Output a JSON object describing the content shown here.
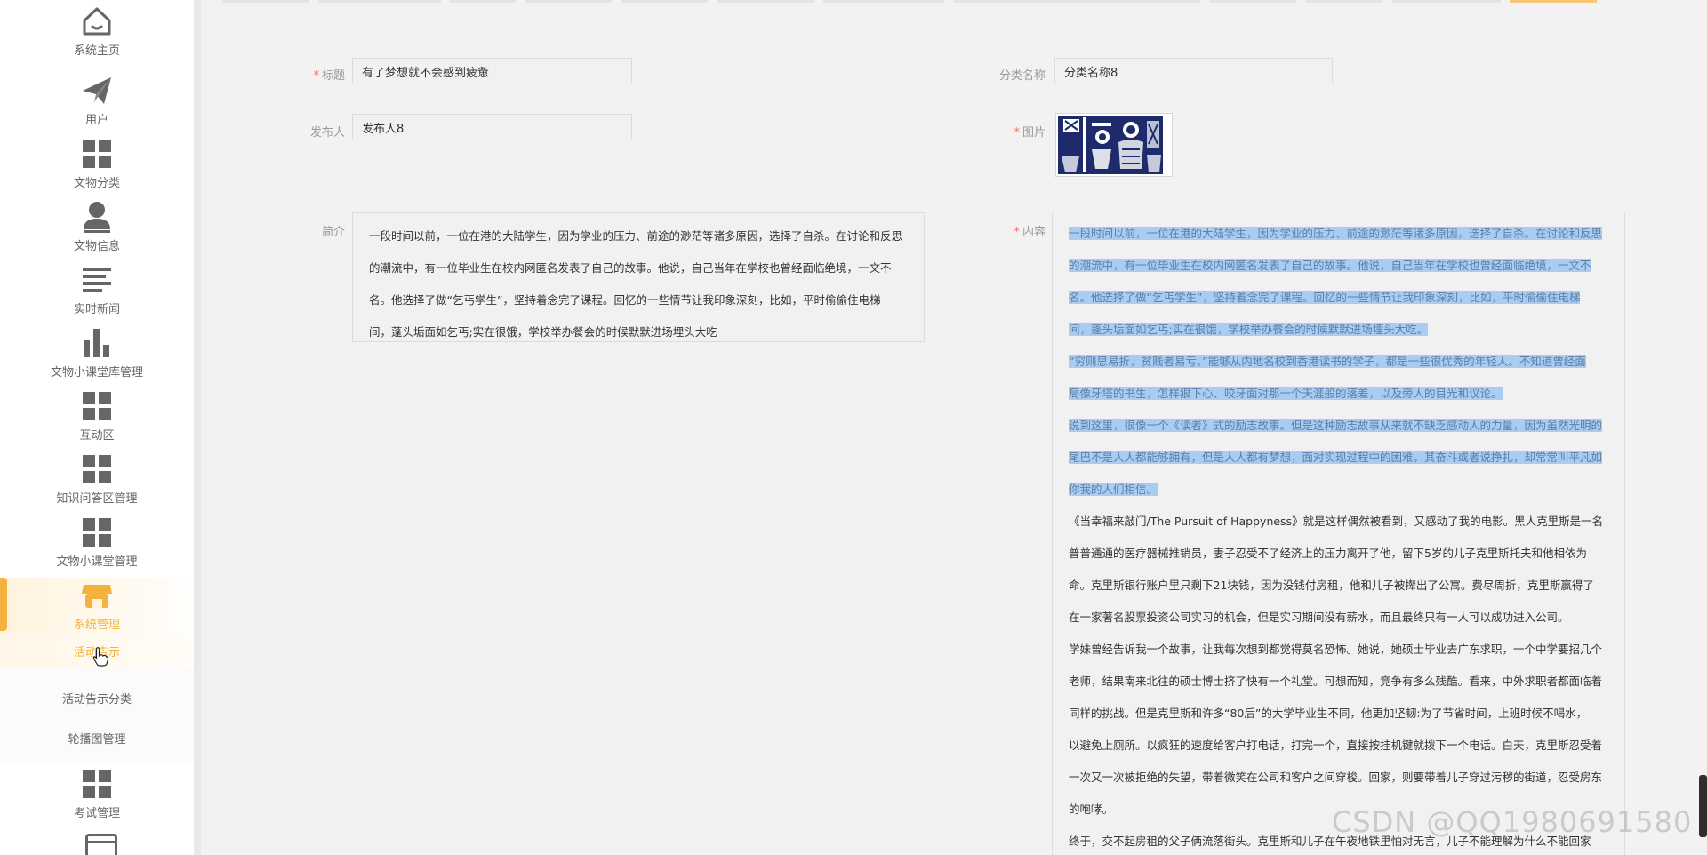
{
  "colors": {
    "accent": "#f3b23d",
    "required": "#f56c6c",
    "highlight": "#a9cdf0",
    "icon": "#666666"
  },
  "sidebar": {
    "items": [
      {
        "label": "系统主页",
        "icon": "home-icon"
      },
      {
        "label": "用户",
        "icon": "paper-plane-icon"
      },
      {
        "label": "文物分类",
        "icon": "grid-icon"
      },
      {
        "label": "文物信息",
        "icon": "user-icon"
      },
      {
        "label": "实时新闻",
        "icon": "list-icon"
      },
      {
        "label": "文物小课堂库管理",
        "icon": "bar-chart-icon"
      },
      {
        "label": "互动区",
        "icon": "grid-icon"
      },
      {
        "label": "知识问答区管理",
        "icon": "grid-icon"
      },
      {
        "label": "文物小课堂管理",
        "icon": "grid-icon"
      },
      {
        "label": "系统管理",
        "icon": "shop-icon",
        "active": true
      },
      {
        "label": "考试管理",
        "icon": "grid-icon"
      }
    ],
    "sub_items": [
      {
        "label": "活动告示",
        "active": true
      },
      {
        "label": "活动告示分类"
      },
      {
        "label": "轮播图管理"
      }
    ]
  },
  "form": {
    "title": {
      "label": "标题",
      "required": true,
      "value": "有了梦想就不会感到疲惫"
    },
    "category": {
      "label": "分类名称",
      "required": false,
      "value": "分类名称8"
    },
    "publisher": {
      "label": "发布人",
      "required": false,
      "value": "发布人8"
    },
    "image": {
      "label": "图片",
      "required": true
    },
    "summary": {
      "label": "简介",
      "required": false,
      "lines": [
        "一段时间以前，一位在港的大陆学生，因为学业的压力、前途的渺茫等诸多原因，选择了自杀。在讨论和反思",
        "的潮流中，有一位毕业生在校内网匿名发表了自己的故事。他说，自己当年在学校也曾经面临绝境，一文不",
        "名。他选择了做“乞丐学生”，坚持着念完了课程。回忆的一些情节让我印象深刻，比如，平时偷偷住电梯",
        "间，蓬头垢面如乞丐;实在很饿，学校举办餐会的时候默默进场埋头大吃"
      ]
    },
    "content": {
      "label": "内容",
      "required": true,
      "highlighted_lines": [
        "一段时间以前，一位在港的大陆学生，因为学业的压力、前途的渺茫等诸多原因，选择了自杀。在讨论和反思",
        "的潮流中，有一位毕业生在校内网匿名发表了自己的故事。他说，自己当年在学校也曾经面临绝境，一文不",
        "名。他选择了做“乞丐学生”，坚持着念完了课程。回忆的一些情节让我印象深刻，比如，平时偷偷住电梯",
        "间，蓬头垢面如乞丐;实在很饿，学校举办餐会的时候默默进场埋头大吃。",
        "“穷则思易折，贫贱者易亏。”能够从内地名校到香港读书的学子，都是一些很优秀的年轻人。不知道曾经面",
        "局像牙塔的书生，怎样狠下心、咬牙面对那一个天涯般的落差，以及旁人的目光和议论。",
        "说到这里，很像一个《读者》式的励志故事。但是这种励志故事从来就不缺乏感动人的力量，因为虽然光明的",
        "尾巴不是人人都能够拥有，但是人人都有梦想，面对实现过程中的困难，其奋斗或者说挣扎，却常常叫平凡如",
        "你我的人们相信。"
      ],
      "lines": [
        "《当幸福来敲门/The Pursuit of Happyness》就是这样偶然被看到，又感动了我的电影。黑人克里斯是一名",
        "普普通通的医疗器械推销员，妻子忍受不了经济上的压力离开了他，留下5岁的儿子克里斯托夫和他相依为",
        "命。克里斯银行账户里只剩下21块钱，因为没钱付房租，他和儿子被撵出了公寓。费尽周折，克里斯赢得了",
        "在一家著名股票投资公司实习的机会，但是实习期间没有薪水，而且最终只有一人可以成功进入公司。",
        "学妹曾经告诉我一个故事，让我每次想到都觉得莫名恐怖。她说，她硕士毕业去广东求职，一个中学要招几个",
        "老师，结果南来北往的硕士博士挤了快有一个礼堂。可想而知，竞争有多么残酷。看来，中外求职者都面临着",
        "同样的挑战。但是克里斯和许多“80后”的大学毕业生不同，他更加坚韧:为了节省时间，上班时候不喝水，",
        "以避免上厕所。以疯狂的速度给客户打电话，打完一个，直接按挂机键就拨下一个电话。白天，克里斯忍受着",
        "一次又一次被拒绝的失望，带着微笑在公司和客户之间穿梭。回家，则要带着儿子穿过污秽的街道，忍受房东",
        "的咆哮。",
        "终于，交不起房租的父子俩流落街头。克里斯和儿子在午夜地铁里怕对无言，儿子不能理解为什么不能回家"
      ]
    }
  },
  "watermark": "CSDN @QQ1980691580"
}
